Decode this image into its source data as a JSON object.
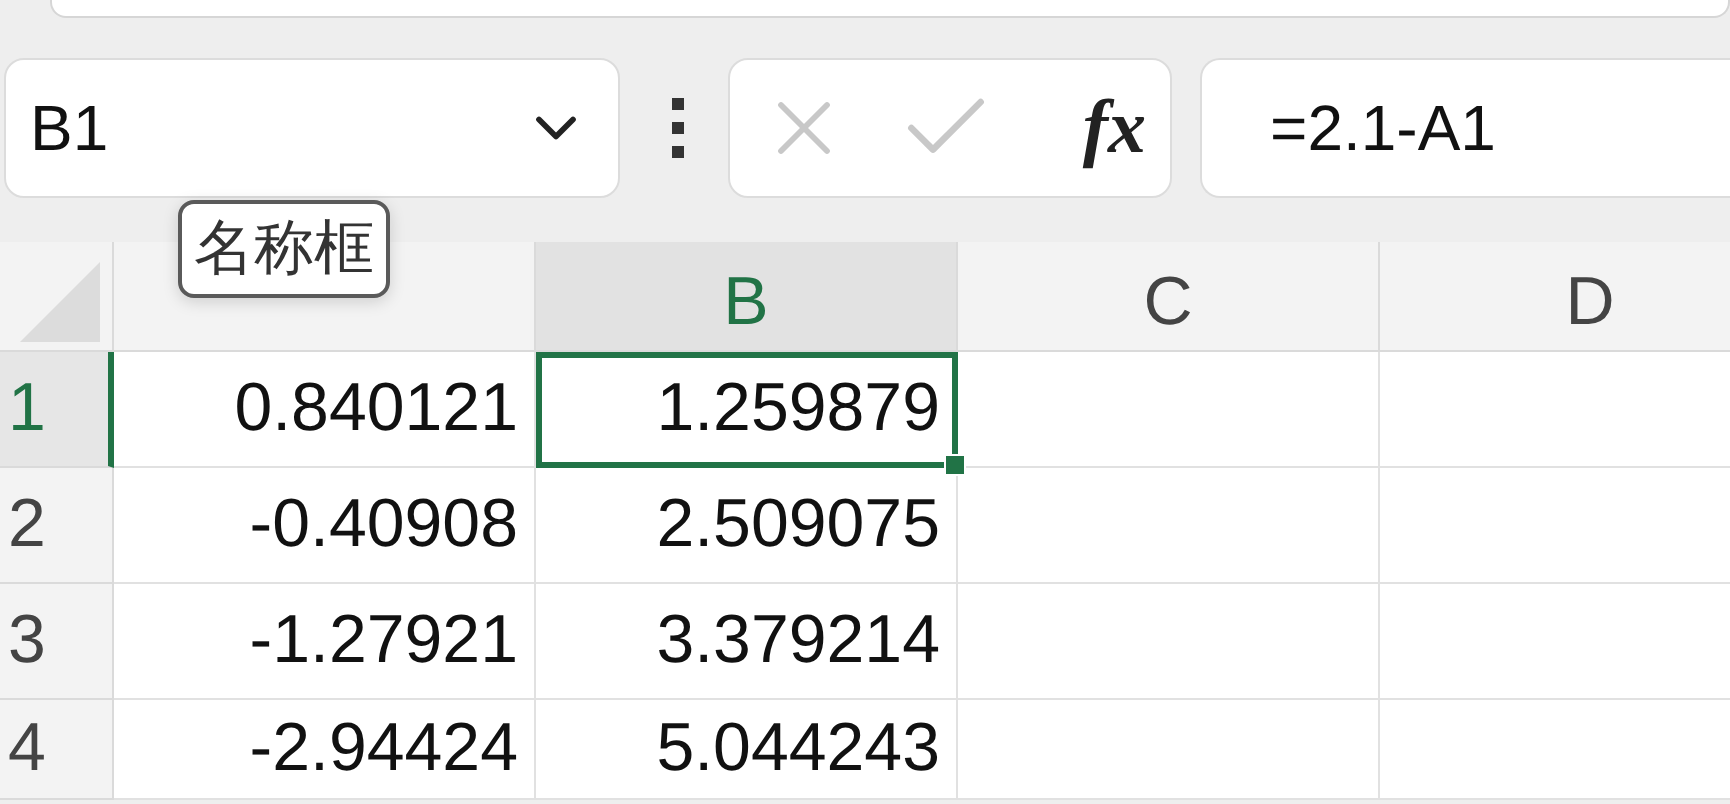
{
  "formula_bar": {
    "name_box": "B1",
    "function_button": "fx",
    "formula": "=2.1-A1"
  },
  "tooltip": {
    "text": "名称框"
  },
  "sheet": {
    "columns": [
      {
        "selected": false
      },
      {
        "label": "B",
        "selected": true
      },
      {
        "label": "C",
        "selected": false
      },
      {
        "label": "D",
        "selected": false
      }
    ],
    "rows": [
      {
        "label": "1",
        "selected": true,
        "cells": [
          {
            "value": "0.840121",
            "selected": false
          },
          {
            "value": "1.259879",
            "selected": true
          },
          {
            "selected": false
          },
          {
            "selected": false
          }
        ]
      },
      {
        "label": "2",
        "selected": false,
        "cells": [
          {
            "value": "-0.40908",
            "selected": false
          },
          {
            "value": "2.509075",
            "selected": false
          },
          {
            "selected": false
          },
          {
            "selected": false
          }
        ]
      },
      {
        "label": "3",
        "selected": false,
        "cells": [
          {
            "value": "-1.27921",
            "selected": false
          },
          {
            "value": "3.379214",
            "selected": false
          },
          {
            "selected": false
          },
          {
            "selected": false
          }
        ]
      },
      {
        "label": "4",
        "selected": false,
        "cells": [
          {
            "value": "-2.94424",
            "selected": false
          },
          {
            "value": "5.044243",
            "selected": false
          },
          {
            "selected": false
          },
          {
            "selected": false
          }
        ]
      }
    ]
  }
}
